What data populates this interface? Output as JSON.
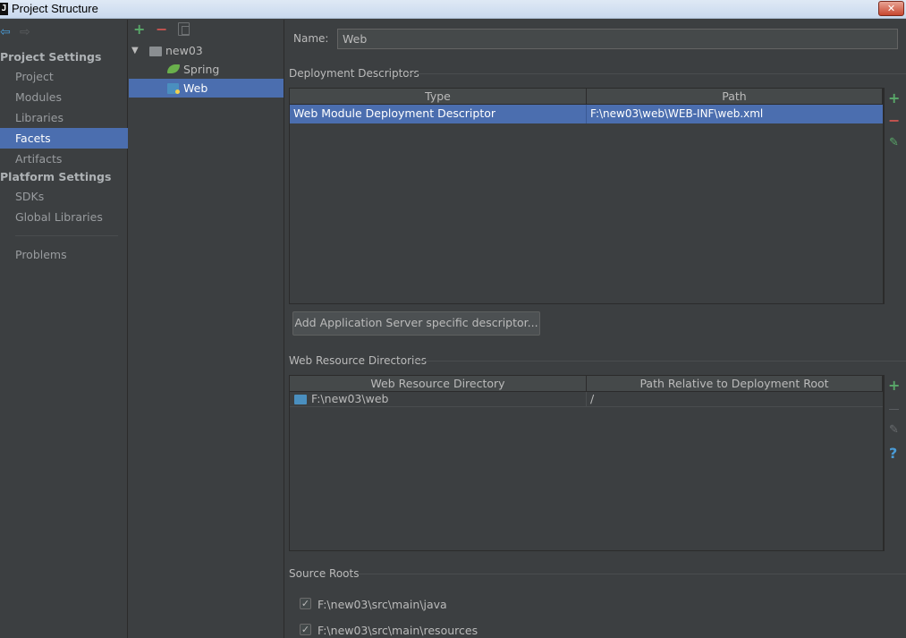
{
  "window": {
    "title": "Project Structure",
    "app_icon": "J",
    "close_glyph": "✕"
  },
  "nav": {
    "back_glyph": "⇦",
    "forward_glyph": "⇨",
    "project_settings_header": "Project Settings",
    "platform_settings_header": "Platform Settings",
    "items": {
      "project": "Project",
      "modules": "Modules",
      "libraries": "Libraries",
      "facets": "Facets",
      "artifacts": "Artifacts",
      "sdks": "SDKs",
      "global_libraries": "Global Libraries",
      "problems": "Problems"
    },
    "selected": "facets"
  },
  "tree": {
    "toolbar": {
      "add": "+",
      "remove": "−"
    },
    "expand_glyph": "▼",
    "root": "new03",
    "children": [
      "Spring",
      "Web"
    ],
    "selected": "Web"
  },
  "form": {
    "name_label": "Name:",
    "name_value": "Web"
  },
  "deployment": {
    "title": "Deployment Descriptors",
    "columns": [
      "Type",
      "Path"
    ],
    "rows": [
      {
        "type": "Web Module Deployment Descriptor",
        "path": "F:\\new03\\web\\WEB-INF\\web.xml"
      }
    ],
    "add_server_button": "Add Application Server specific descriptor...",
    "toolbar": {
      "add": "+",
      "remove": "−",
      "edit": "✎"
    }
  },
  "web_resources": {
    "title": "Web Resource Directories",
    "columns": [
      "Web Resource Directory",
      "Path Relative to Deployment Root"
    ],
    "rows": [
      {
        "dir": "F:\\new03\\web",
        "relative": "/"
      }
    ],
    "toolbar": {
      "add": "+",
      "remove": "−",
      "edit": "✎",
      "help": "?"
    }
  },
  "source_roots": {
    "title": "Source Roots",
    "items": [
      {
        "path": "F:\\new03\\src\\main\\java",
        "checked": true
      },
      {
        "path": "F:\\new03\\src\\main\\resources",
        "checked": true
      }
    ],
    "check_glyph": "✓"
  },
  "colors": {
    "background": "#3c3f41",
    "selection": "#4b6eaf",
    "add_green": "#59a869",
    "remove_red": "#c75450",
    "help_blue": "#4a9bd6"
  }
}
